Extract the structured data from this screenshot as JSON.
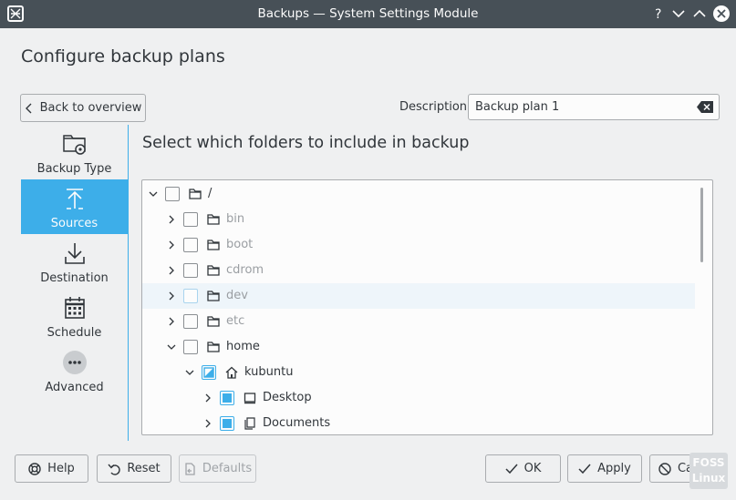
{
  "window": {
    "title": "Backups — System Settings Module"
  },
  "page": {
    "heading": "Configure backup plans"
  },
  "toolbar": {
    "back_label": "Back to overview",
    "description_label": "Description:",
    "description_value": "Backup plan 1"
  },
  "sidebar": {
    "items": [
      {
        "label": "Backup Type",
        "icon": "folder-gear-icon",
        "active": false
      },
      {
        "label": "Sources",
        "icon": "upload-icon",
        "active": true
      },
      {
        "label": "Destination",
        "icon": "download-icon",
        "active": false
      },
      {
        "label": "Schedule",
        "icon": "calendar-icon",
        "active": false
      },
      {
        "label": "Advanced",
        "icon": "more-icon",
        "active": false
      }
    ]
  },
  "main": {
    "title": "Select which folders to include in backup",
    "tree": [
      {
        "name": "/",
        "depth": 0,
        "expanded": true,
        "check": "unchecked",
        "dim": false,
        "icon": "folder-icon"
      },
      {
        "name": "bin",
        "depth": 1,
        "expanded": false,
        "check": "unchecked",
        "dim": true,
        "icon": "folder-icon"
      },
      {
        "name": "boot",
        "depth": 1,
        "expanded": false,
        "check": "unchecked",
        "dim": true,
        "icon": "folder-icon"
      },
      {
        "name": "cdrom",
        "depth": 1,
        "expanded": false,
        "check": "unchecked",
        "dim": true,
        "icon": "folder-icon"
      },
      {
        "name": "dev",
        "depth": 1,
        "expanded": false,
        "check": "faint",
        "dim": true,
        "icon": "folder-icon",
        "hover": true
      },
      {
        "name": "etc",
        "depth": 1,
        "expanded": false,
        "check": "unchecked",
        "dim": true,
        "icon": "folder-icon"
      },
      {
        "name": "home",
        "depth": 1,
        "expanded": true,
        "check": "unchecked",
        "dim": false,
        "icon": "folder-icon"
      },
      {
        "name": "kubuntu",
        "depth": 2,
        "expanded": true,
        "check": "partial",
        "dim": false,
        "icon": "home-icon"
      },
      {
        "name": "Desktop",
        "depth": 3,
        "expanded": false,
        "check": "checked",
        "dim": false,
        "icon": "desktop-icon"
      },
      {
        "name": "Documents",
        "depth": 3,
        "expanded": false,
        "check": "checked",
        "dim": false,
        "icon": "documents-icon"
      }
    ]
  },
  "footer": {
    "help_label": "Help",
    "reset_label": "Reset",
    "defaults_label": "Defaults",
    "ok_label": "OK",
    "apply_label": "Apply",
    "cancel_label": "Cancel"
  },
  "watermark": {
    "line1": "FOSS",
    "line2": "Linux"
  },
  "colors": {
    "accent": "#3daee9",
    "titlebar": "#475057",
    "background": "#eff0f1"
  }
}
